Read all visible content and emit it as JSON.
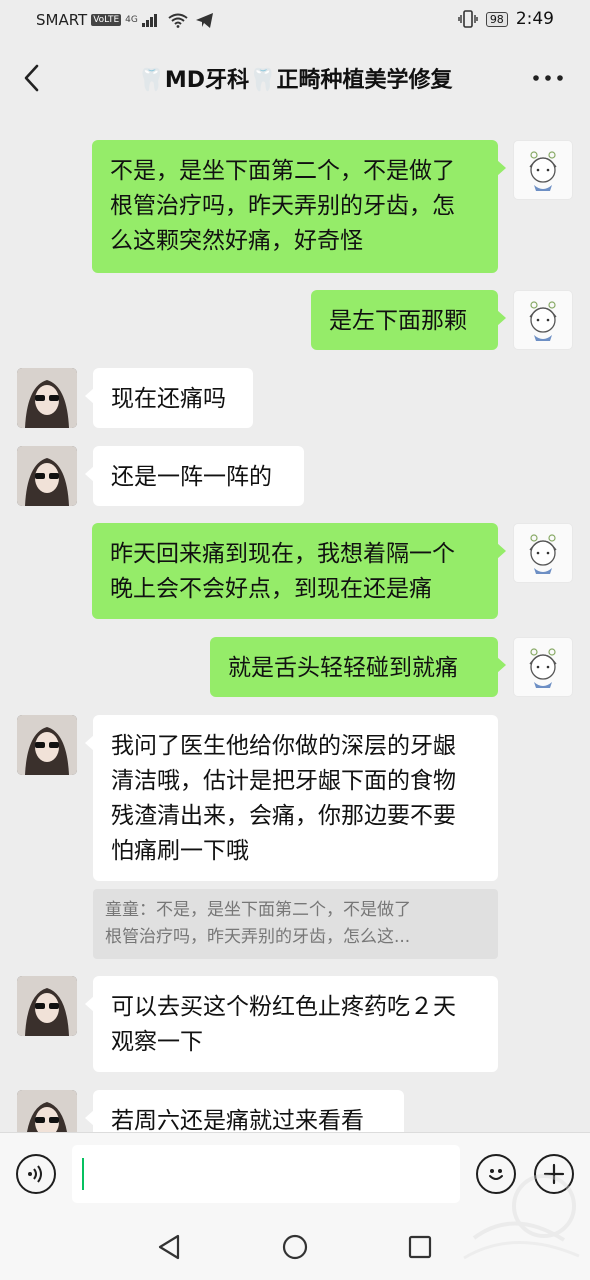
{
  "status_bar": {
    "carrier": "SMART",
    "volte": "VoLTE",
    "network": "4G",
    "battery": "98",
    "time": "2:49"
  },
  "header": {
    "title": "🦷MD牙科🦷正畸种植美学修复",
    "back_icon": "chevron-left-icon",
    "more_icon": "ellipsis-icon"
  },
  "messages": [
    {
      "sender": "self",
      "lines": [
        "不是，是坐下面第二个，不是做了",
        "根管治疗吗，昨天弄别的牙齿，怎",
        "么这颗突然好痛，好奇怪"
      ]
    },
    {
      "sender": "self",
      "lines": [
        "是左下面那颗"
      ]
    },
    {
      "sender": "other",
      "lines": [
        "现在还痛吗"
      ]
    },
    {
      "sender": "other",
      "lines": [
        "还是一阵一阵的"
      ]
    },
    {
      "sender": "self",
      "lines": [
        "昨天回来痛到现在，我想着隔一个",
        "晚上会不会好点，到现在还是痛"
      ]
    },
    {
      "sender": "self",
      "lines": [
        "就是舌头轻轻碰到就痛"
      ]
    },
    {
      "sender": "other",
      "lines": [
        "我问了医生他给你做的深层的牙龈",
        "清洁哦，估计是把牙龈下面的食物",
        "残渣清出来，会痛，你那边要不要",
        "怕痛刷一下哦"
      ]
    },
    {
      "sender": "other",
      "lines": [
        "可以去买这个粉红色止疼药吃２天",
        "观察一下"
      ]
    },
    {
      "sender": "other",
      "lines": [
        "若周六还是痛就过来看看"
      ]
    }
  ],
  "quote": {
    "lines": [
      "童童：不是，是坐下面第二个，不是做了",
      "根管治疗吗，昨天弄别的牙齿，怎么这..."
    ]
  },
  "input_bar": {
    "voice_icon": "voice-icon",
    "emoji_icon": "emoji-icon",
    "plus_icon": "plus-icon",
    "value": ""
  },
  "nav_bar": {
    "back_icon": "triangle-back-icon",
    "home_icon": "circle-home-icon",
    "recents_icon": "square-recents-icon"
  },
  "colors": {
    "self_bubble": "#95ec69",
    "other_bubble": "#ffffff",
    "background": "#ededed"
  }
}
